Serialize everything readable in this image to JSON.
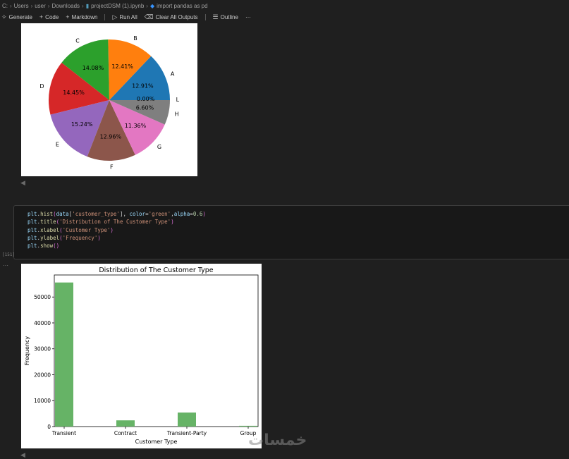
{
  "breadcrumb": {
    "items": [
      "C:",
      "Users",
      "user",
      "Downloads",
      "projectDSM (1).ipynb",
      "import pandas as pd"
    ]
  },
  "toolbar": {
    "generate": "Generate",
    "code": "Code",
    "markdown": "Markdown",
    "run_all": "Run All",
    "clear_all_outputs": "Clear All Outputs",
    "outline": "Outline",
    "more": "···"
  },
  "pie_output": {
    "chart_data": {
      "type": "pie",
      "slices": [
        {
          "label": "A",
          "pct": "12.91%",
          "value": 12.91,
          "color": "#1f77b4"
        },
        {
          "label": "B",
          "pct": "12.41%",
          "value": 12.41,
          "color": "#ff7f0e"
        },
        {
          "label": "C",
          "pct": "14.08%",
          "value": 14.08,
          "color": "#2ca02c"
        },
        {
          "label": "D",
          "pct": "14.45%",
          "value": 14.45,
          "color": "#d62728"
        },
        {
          "label": "E",
          "pct": "15.24%",
          "value": 15.24,
          "color": "#9467bd"
        },
        {
          "label": "F",
          "pct": "12.96%",
          "value": 12.96,
          "color": "#8c564b"
        },
        {
          "label": "G",
          "pct": "11.36%",
          "value": 11.36,
          "color": "#e377c2"
        },
        {
          "label": "H",
          "pct": "6.60%",
          "value": 6.6,
          "color": "#7f7f7f"
        },
        {
          "label": "L",
          "pct": "0.00%",
          "value": 0.0,
          "color": "#bcbd22"
        }
      ],
      "start_angle": 0,
      "direction": "counterclockwise"
    }
  },
  "code_cell": {
    "execution_count": "[151]",
    "lines": [
      [
        {
          "t": "plt",
          "c": "k-var"
        },
        {
          "t": ".",
          "c": "k-pn"
        },
        {
          "t": "hist",
          "c": "k-fn"
        },
        {
          "t": "(",
          "c": "k-br"
        },
        {
          "t": "data",
          "c": "k-var"
        },
        {
          "t": "[",
          "c": "k-pn"
        },
        {
          "t": "'customer_type'",
          "c": "k-str"
        },
        {
          "t": "], ",
          "c": "k-pn"
        },
        {
          "t": "color",
          "c": "k-var"
        },
        {
          "t": "=",
          "c": "k-pn"
        },
        {
          "t": "'green'",
          "c": "k-str"
        },
        {
          "t": ",",
          "c": "k-pn"
        },
        {
          "t": "alpha",
          "c": "k-var"
        },
        {
          "t": "=",
          "c": "k-pn"
        },
        {
          "t": "0.6",
          "c": "k-num"
        },
        {
          "t": ")",
          "c": "k-br"
        }
      ],
      [
        {
          "t": "plt",
          "c": "k-var"
        },
        {
          "t": ".",
          "c": "k-pn"
        },
        {
          "t": "title",
          "c": "k-fn"
        },
        {
          "t": "(",
          "c": "k-br"
        },
        {
          "t": "'Distribution of The Customer Type'",
          "c": "k-str"
        },
        {
          "t": ")",
          "c": "k-br"
        }
      ],
      [
        {
          "t": "plt",
          "c": "k-var"
        },
        {
          "t": ".",
          "c": "k-pn"
        },
        {
          "t": "xlabel",
          "c": "k-fn"
        },
        {
          "t": "(",
          "c": "k-br"
        },
        {
          "t": "'Customer Type'",
          "c": "k-str"
        },
        {
          "t": ")",
          "c": "k-br"
        }
      ],
      [
        {
          "t": "plt",
          "c": "k-var"
        },
        {
          "t": ".",
          "c": "k-pn"
        },
        {
          "t": "ylabel",
          "c": "k-fn"
        },
        {
          "t": "(",
          "c": "k-br"
        },
        {
          "t": "'Frequency'",
          "c": "k-str"
        },
        {
          "t": ")",
          "c": "k-br"
        }
      ],
      [
        {
          "t": "plt",
          "c": "k-var"
        },
        {
          "t": ".",
          "c": "k-pn"
        },
        {
          "t": "show",
          "c": "k-fn"
        },
        {
          "t": "()",
          "c": "k-br"
        }
      ]
    ]
  },
  "output_dots": "···",
  "hist_output": {
    "chart_data": {
      "type": "bar",
      "title": "Distribution of The Customer Type",
      "xlabel": "Customer Type",
      "ylabel": "Frequency",
      "categories": [
        "Transient",
        "Contract",
        "Transient-Party",
        "Group"
      ],
      "values": [
        55600,
        2400,
        5400,
        300
      ],
      "color": "#66b366",
      "yticks": [
        "0",
        "10000",
        "20000",
        "30000",
        "40000",
        "50000"
      ],
      "ylim": [
        0,
        58500
      ]
    }
  },
  "watermark": "خمسات"
}
